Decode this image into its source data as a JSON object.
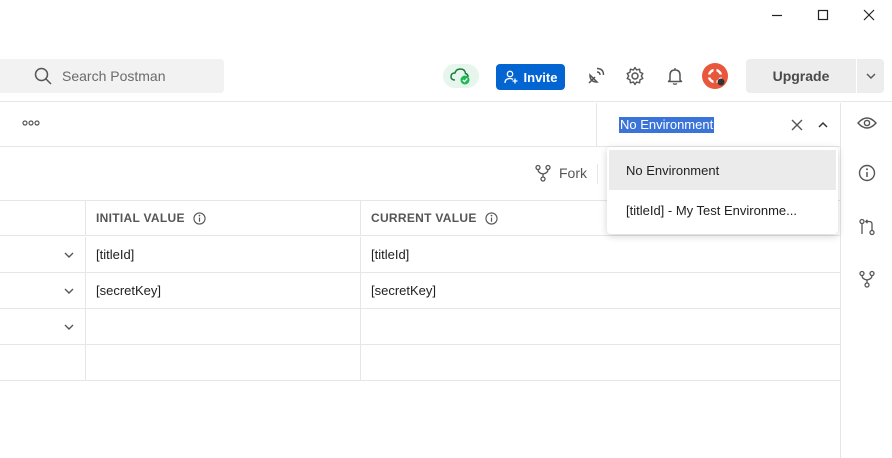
{
  "search": {
    "placeholder": "Search Postman"
  },
  "header": {
    "invite_label": "Invite",
    "upgrade_label": "Upgrade",
    "sync_status_color": "#1db954",
    "invite_color": "#0265d2",
    "avatar_color": "#e8573c"
  },
  "environment": {
    "selected": "No Environment",
    "options": [
      "No Environment",
      "[titleId] - My Test Environme..."
    ]
  },
  "toolbar": {
    "fork_label": "Fork"
  },
  "table": {
    "headers": {
      "initial": "INITIAL VALUE",
      "current": "CURRENT VALUE"
    },
    "rows": [
      {
        "initial": "[titleId]",
        "current": "[titleId]"
      },
      {
        "initial": "[secretKey]",
        "current": "[secretKey]"
      },
      {
        "initial": "",
        "current": ""
      },
      {
        "initial": "",
        "current": ""
      }
    ]
  },
  "icons": {
    "window": [
      "minimize-icon",
      "maximize-icon",
      "close-icon"
    ],
    "header": [
      "search-icon",
      "cloud-sync-icon",
      "add-user-icon",
      "satellite-icon",
      "gear-icon",
      "bell-icon",
      "avatar-icon",
      "chevron-down-icon"
    ],
    "right_sidebar": [
      "eye-icon",
      "info-icon",
      "pull-request-icon",
      "fork-icon"
    ]
  }
}
